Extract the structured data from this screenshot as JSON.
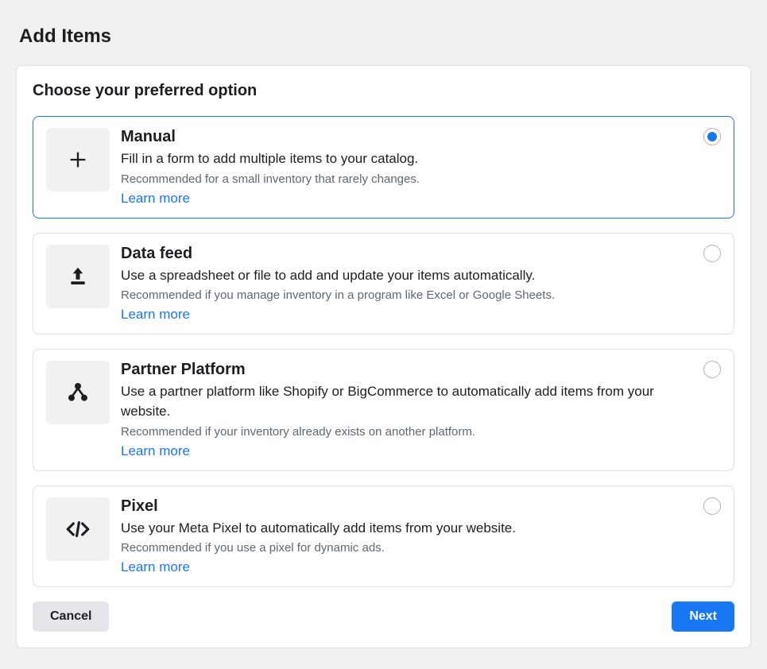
{
  "page": {
    "title": "Add Items",
    "subtitle": "Choose your preferred option"
  },
  "options": [
    {
      "icon": "plus-icon",
      "title": "Manual",
      "description": "Fill in a form to add multiple items to your catalog.",
      "recommendation": "Recommended for a small inventory that rarely changes.",
      "learn_more": "Learn more",
      "selected": true
    },
    {
      "icon": "upload-icon",
      "title": "Data feed",
      "description": "Use a spreadsheet or file to add and update your items automatically.",
      "recommendation": "Recommended if you manage inventory in a program like Excel or Google Sheets.",
      "learn_more": "Learn more",
      "selected": false
    },
    {
      "icon": "network-icon",
      "title": "Partner Platform",
      "description": "Use a partner platform like Shopify or BigCommerce to automatically add items from your website.",
      "recommendation": "Recommended if your inventory already exists on another platform.",
      "learn_more": "Learn more",
      "selected": false
    },
    {
      "icon": "code-icon",
      "title": "Pixel",
      "description": "Use your Meta Pixel to automatically add items from your website.",
      "recommendation": "Recommended if you use a pixel for dynamic ads.",
      "learn_more": "Learn more",
      "selected": false
    }
  ],
  "footer": {
    "cancel": "Cancel",
    "next": "Next"
  }
}
